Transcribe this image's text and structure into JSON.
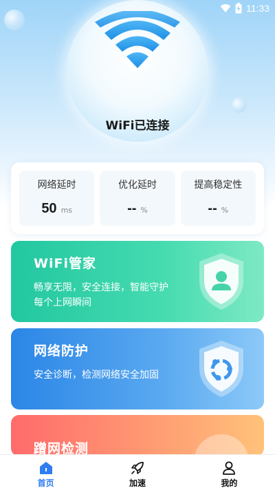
{
  "status_bar": {
    "time": "11:33",
    "icons": [
      "wifi-icon",
      "battery-icon"
    ]
  },
  "header": {
    "connection_status": "WiFi已连接"
  },
  "stats": [
    {
      "label": "网络延时",
      "value": "50",
      "unit": "ms"
    },
    {
      "label": "优化延时",
      "value": "--",
      "unit": "%"
    },
    {
      "label": "提高稳定性",
      "value": "--",
      "unit": "%"
    }
  ],
  "cards": {
    "wifi_manager": {
      "title": "WiFi管家",
      "desc": "畅享无限，安全连接，智能守护每个上网瞬间",
      "icon": "user-shield-icon"
    },
    "net_protect": {
      "title": "网络防护",
      "desc": "安全诊断，检测网络安全加固",
      "icon": "network-shield-icon"
    },
    "leech_detect": {
      "title": "蹭网检测",
      "icon": "wifi-detect-icon"
    }
  },
  "nav": [
    {
      "label": "首页",
      "icon": "home-icon",
      "active": true
    },
    {
      "label": "加速",
      "icon": "rocket-icon",
      "active": false
    },
    {
      "label": "我的",
      "icon": "user-icon",
      "active": false
    }
  ],
  "colors": {
    "accent": "#2f7df0",
    "wifi_card": "#22c7a0",
    "net_card": "#2b86e6",
    "detect_card": "#ff6b6b"
  }
}
